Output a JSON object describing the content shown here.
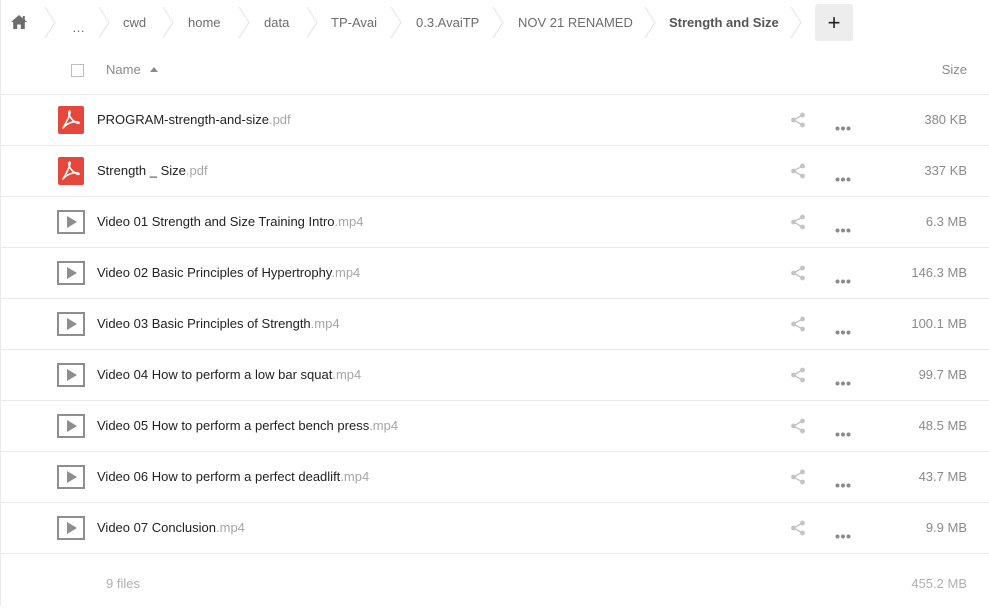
{
  "breadcrumb": {
    "items": [
      {
        "label": "…",
        "key": "ellipsis"
      },
      {
        "label": "cwd",
        "key": "cwd"
      },
      {
        "label": "home",
        "key": "home"
      },
      {
        "label": "data",
        "key": "data"
      },
      {
        "label": "TP-Avai",
        "key": "tp-avai"
      },
      {
        "label": "0.3.AvaiTP",
        "key": "avaitp"
      },
      {
        "label": "NOV 21 RENAMED",
        "key": "nov21"
      },
      {
        "label": "Strength and Size",
        "key": "current"
      }
    ],
    "add_label": "+"
  },
  "header": {
    "name_label": "Name",
    "size_label": "Size"
  },
  "files": [
    {
      "base": "PROGRAM-strength-and-size",
      "ext": ".pdf",
      "type": "pdf",
      "size": "380 KB"
    },
    {
      "base": "Strength _ Size",
      "ext": ".pdf",
      "type": "pdf",
      "size": "337 KB"
    },
    {
      "base": "Video 01 Strength and Size Training Intro",
      "ext": ".mp4",
      "type": "video",
      "size": "6.3 MB"
    },
    {
      "base": "Video 02 Basic Principles of Hypertrophy",
      "ext": ".mp4",
      "type": "video",
      "size": "146.3 MB"
    },
    {
      "base": "Video 03 Basic Principles of Strength",
      "ext": ".mp4",
      "type": "video",
      "size": "100.1 MB"
    },
    {
      "base": "Video 04 How to perform a low bar squat",
      "ext": ".mp4",
      "type": "video",
      "size": "99.7 MB"
    },
    {
      "base": "Video 05 How to perform a perfect bench press",
      "ext": ".mp4",
      "type": "video",
      "size": "48.5 MB"
    },
    {
      "base": "Video 06 How to perform a perfect deadlift",
      "ext": ".mp4",
      "type": "video",
      "size": "43.7 MB"
    },
    {
      "base": "Video 07 Conclusion",
      "ext": ".mp4",
      "type": "video",
      "size": "9.9 MB"
    }
  ],
  "summary": {
    "count_label": "9 files",
    "total_size": "455.2 MB"
  },
  "colors": {
    "pdf_red": "#e5473c",
    "icon_gray": "#8e8e8e",
    "action_gray": "#c4c4c4"
  },
  "icons": {
    "home": "home-icon",
    "pdf": "pdf-icon",
    "video": "video-play-icon",
    "share": "share-icon",
    "more": "more-icon"
  }
}
